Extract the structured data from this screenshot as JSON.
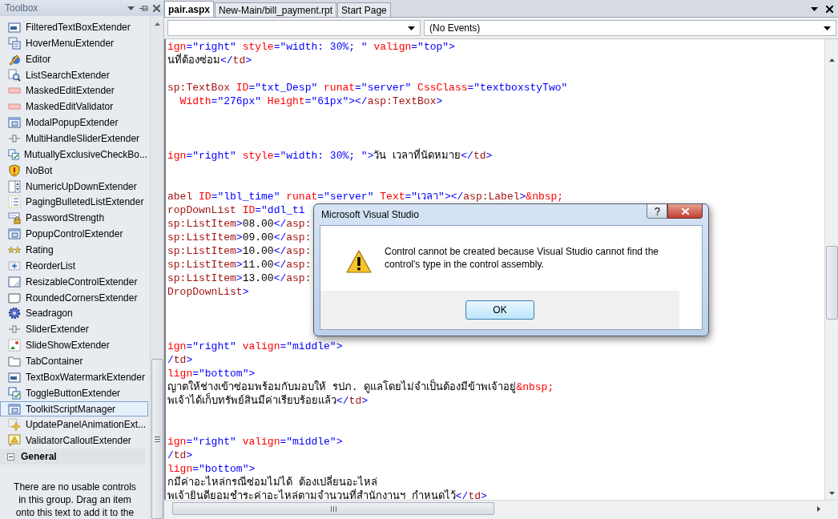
{
  "toolbox": {
    "title": "Toolbox",
    "items": [
      {
        "label": "FilteredTextBoxExtender",
        "selected": false
      },
      {
        "label": "HoverMenuExtender",
        "selected": false
      },
      {
        "label": "Editor",
        "selected": false
      },
      {
        "label": "ListSearchExtender",
        "selected": false
      },
      {
        "label": "MaskedEditExtender",
        "selected": false
      },
      {
        "label": "MaskedEditValidator",
        "selected": false
      },
      {
        "label": "ModalPopupExtender",
        "selected": false
      },
      {
        "label": "MultiHandleSliderExtender",
        "selected": false
      },
      {
        "label": "MutuallyExclusiveCheckBo...",
        "selected": false
      },
      {
        "label": "NoBot",
        "selected": false
      },
      {
        "label": "NumericUpDownExtender",
        "selected": false
      },
      {
        "label": "PagingBulletedListExtender",
        "selected": false
      },
      {
        "label": "PasswordStrength",
        "selected": false
      },
      {
        "label": "PopupControlExtender",
        "selected": false
      },
      {
        "label": "Rating",
        "selected": false
      },
      {
        "label": "ReorderList",
        "selected": false
      },
      {
        "label": "ResizableControlExtender",
        "selected": false
      },
      {
        "label": "RoundedCornersExtender",
        "selected": false
      },
      {
        "label": "Seadragon",
        "selected": false
      },
      {
        "label": "SliderExtender",
        "selected": false
      },
      {
        "label": "SlideShowExtender",
        "selected": false
      },
      {
        "label": "TabContainer",
        "selected": false
      },
      {
        "label": "TextBoxWatermarkExtender",
        "selected": false
      },
      {
        "label": "ToggleButtonExtender",
        "selected": false
      },
      {
        "label": "ToolkitScriptManager",
        "selected": true
      },
      {
        "label": "UpdatePanelAnimationExt...",
        "selected": false
      },
      {
        "label": "ValidatorCalloutExtender",
        "selected": false
      }
    ],
    "group": {
      "label": "General",
      "expanded": true
    },
    "empty_message": "There are no usable controls in this group. Drag an item onto this text to add it to the"
  },
  "editor": {
    "tabs": [
      {
        "label": "pair.aspx",
        "selected": true
      },
      {
        "label": "New-Main/bill_payment.rpt",
        "selected": false
      },
      {
        "label": "Start Page",
        "selected": false
      }
    ],
    "event_dropdown": {
      "value": "(No Events)"
    },
    "lines": [
      {
        "kind": "code",
        "tokens": [
          {
            "kind": "attr",
            "text": "ign"
          },
          {
            "kind": "value",
            "text": "=\"right\" "
          },
          {
            "kind": "attr",
            "text": "style"
          },
          {
            "kind": "value",
            "text": "=\"width: 30%; \" "
          },
          {
            "kind": "attr",
            "text": "valign"
          },
          {
            "kind": "value",
            "text": "=\"top\">"
          }
        ]
      },
      {
        "kind": "code",
        "tokens": [
          {
            "kind": "text",
            "text": "นที่ต้องซ่อม"
          },
          {
            "kind": "value",
            "text": "</"
          },
          {
            "kind": "element",
            "text": "td"
          },
          {
            "kind": "value",
            "text": ">"
          }
        ]
      },
      {
        "kind": "blank"
      },
      {
        "kind": "code",
        "tokens": [
          {
            "kind": "element",
            "text": "sp:TextBox"
          },
          {
            "kind": "attr",
            "text": " ID"
          },
          {
            "kind": "value",
            "text": "=\"txt_Desp\" "
          },
          {
            "kind": "attr",
            "text": "runat"
          },
          {
            "kind": "value",
            "text": "=\"server\" "
          },
          {
            "kind": "attr",
            "text": "CssClass"
          },
          {
            "kind": "value",
            "text": "=\"textboxstyTwo\""
          }
        ]
      },
      {
        "kind": "code",
        "tokens": [
          {
            "kind": "attr",
            "text": "  Width"
          },
          {
            "kind": "value",
            "text": "=\"276px\" "
          },
          {
            "kind": "attr",
            "text": "Height"
          },
          {
            "kind": "value",
            "text": "=\"61px\"></"
          },
          {
            "kind": "element",
            "text": "asp:TextBox"
          },
          {
            "kind": "value",
            "text": ">"
          }
        ]
      },
      {
        "kind": "blank"
      },
      {
        "kind": "blank"
      },
      {
        "kind": "blank"
      },
      {
        "kind": "code",
        "tokens": [
          {
            "kind": "attr",
            "text": "ign"
          },
          {
            "kind": "value",
            "text": "=\"right\" "
          },
          {
            "kind": "attr",
            "text": "style"
          },
          {
            "kind": "value",
            "text": "=\"width: 30%; \">"
          },
          {
            "kind": "text",
            "text": "วัน เวลาที่นัดหมาย"
          },
          {
            "kind": "value",
            "text": "</"
          },
          {
            "kind": "element",
            "text": "td"
          },
          {
            "kind": "value",
            "text": ">"
          }
        ]
      },
      {
        "kind": "blank"
      },
      {
        "kind": "blank"
      },
      {
        "kind": "code",
        "tokens": [
          {
            "kind": "element",
            "text": "abel"
          },
          {
            "kind": "attr",
            "text": " ID"
          },
          {
            "kind": "value",
            "text": "=\"lbl_time\" "
          },
          {
            "kind": "attr",
            "text": "runat"
          },
          {
            "kind": "value",
            "text": "=\"server\" "
          },
          {
            "kind": "attr",
            "text": "Text"
          },
          {
            "kind": "value",
            "text": "=\"เวลา\"></"
          },
          {
            "kind": "element",
            "text": "asp:Label"
          },
          {
            "kind": "value",
            "text": ">"
          },
          {
            "kind": "attr",
            "text": "&nbsp;"
          }
        ]
      },
      {
        "kind": "code",
        "tokens": [
          {
            "kind": "element",
            "text": "ropDownList"
          },
          {
            "kind": "attr",
            "text": " ID"
          },
          {
            "kind": "value",
            "text": "=\"ddl_ti"
          }
        ]
      },
      {
        "kind": "code",
        "tokens": [
          {
            "kind": "element",
            "text": "sp:ListItem"
          },
          {
            "kind": "value",
            "text": ">"
          },
          {
            "kind": "text",
            "text": "08.00"
          },
          {
            "kind": "value",
            "text": "</"
          },
          {
            "kind": "element",
            "text": "asp:"
          }
        ]
      },
      {
        "kind": "code",
        "tokens": [
          {
            "kind": "element",
            "text": "sp:ListItem"
          },
          {
            "kind": "value",
            "text": ">"
          },
          {
            "kind": "text",
            "text": "09.00"
          },
          {
            "kind": "value",
            "text": "</"
          },
          {
            "kind": "element",
            "text": "asp:"
          }
        ]
      },
      {
        "kind": "code",
        "tokens": [
          {
            "kind": "element",
            "text": "sp:ListItem"
          },
          {
            "kind": "value",
            "text": ">"
          },
          {
            "kind": "text",
            "text": "10.00"
          },
          {
            "kind": "value",
            "text": "</"
          },
          {
            "kind": "element",
            "text": "asp:"
          }
        ]
      },
      {
        "kind": "code",
        "tokens": [
          {
            "kind": "element",
            "text": "sp:ListItem"
          },
          {
            "kind": "value",
            "text": ">"
          },
          {
            "kind": "text",
            "text": "11.00"
          },
          {
            "kind": "value",
            "text": "</"
          },
          {
            "kind": "element",
            "text": "asp:"
          }
        ]
      },
      {
        "kind": "code",
        "tokens": [
          {
            "kind": "element",
            "text": "sp:ListItem"
          },
          {
            "kind": "value",
            "text": ">"
          },
          {
            "kind": "text",
            "text": "13.00"
          },
          {
            "kind": "value",
            "text": "</"
          },
          {
            "kind": "element",
            "text": "asp:"
          }
        ]
      },
      {
        "kind": "code",
        "tokens": [
          {
            "kind": "element",
            "text": "DropDownList"
          },
          {
            "kind": "value",
            "text": ">"
          }
        ]
      },
      {
        "kind": "blank"
      },
      {
        "kind": "blank"
      },
      {
        "kind": "blank"
      },
      {
        "kind": "code",
        "tokens": [
          {
            "kind": "attr",
            "text": "ign"
          },
          {
            "kind": "value",
            "text": "=\"right\" "
          },
          {
            "kind": "attr",
            "text": "valign"
          },
          {
            "kind": "value",
            "text": "=\"middle\">"
          }
        ]
      },
      {
        "kind": "code",
        "tokens": [
          {
            "kind": "value",
            "text": "/"
          },
          {
            "kind": "element",
            "text": "td"
          },
          {
            "kind": "value",
            "text": ">"
          }
        ]
      },
      {
        "kind": "code",
        "tokens": [
          {
            "kind": "attr",
            "text": "lign"
          },
          {
            "kind": "value",
            "text": "=\"bottom\">"
          }
        ]
      },
      {
        "kind": "code",
        "tokens": [
          {
            "kind": "text",
            "text": "ญาตให้ช่างเข้าซ่อมพร้อมกับมอบให้ รปภ. ดูแลโดยไม่จำเป็นต้องมีข้าพเจ้าอยู่"
          },
          {
            "kind": "attr",
            "text": "&nbsp;"
          }
        ]
      },
      {
        "kind": "code",
        "tokens": [
          {
            "kind": "text",
            "text": "พเจ้าได้เก็บทรัพย์สินมีค่าเรียบร้อยแล้ว"
          },
          {
            "kind": "value",
            "text": "</"
          },
          {
            "kind": "element",
            "text": "td"
          },
          {
            "kind": "value",
            "text": ">"
          }
        ]
      },
      {
        "kind": "blank"
      },
      {
        "kind": "blank"
      },
      {
        "kind": "code",
        "tokens": [
          {
            "kind": "attr",
            "text": "ign"
          },
          {
            "kind": "value",
            "text": "=\"right\" "
          },
          {
            "kind": "attr",
            "text": "valign"
          },
          {
            "kind": "value",
            "text": "=\"middle\">"
          }
        ]
      },
      {
        "kind": "code",
        "tokens": [
          {
            "kind": "value",
            "text": "/"
          },
          {
            "kind": "element",
            "text": "td"
          },
          {
            "kind": "value",
            "text": ">"
          }
        ]
      },
      {
        "kind": "code",
        "tokens": [
          {
            "kind": "attr",
            "text": "lign"
          },
          {
            "kind": "value",
            "text": "=\"bottom\">"
          }
        ]
      },
      {
        "kind": "code",
        "tokens": [
          {
            "kind": "text",
            "text": "กมีค่าอะไหล่กรณีซ่อมไม่ได้ ต้องเปลี่ยนอะไหล่"
          }
        ]
      },
      {
        "kind": "code",
        "tokens": [
          {
            "kind": "text",
            "text": "พเจ้ายินดียอมชำระค่าอะไหล่ตามจำนวนที่สำนักงานฯ กำหนดไว้"
          },
          {
            "kind": "value",
            "text": "</"
          },
          {
            "kind": "element",
            "text": "td"
          },
          {
            "kind": "value",
            "text": ">"
          }
        ]
      }
    ]
  },
  "dialog": {
    "title": "Microsoft Visual Studio",
    "message": "Control cannot be created because Visual Studio cannot find the control's type in the control assembly.",
    "buttons": [
      "OK"
    ]
  }
}
